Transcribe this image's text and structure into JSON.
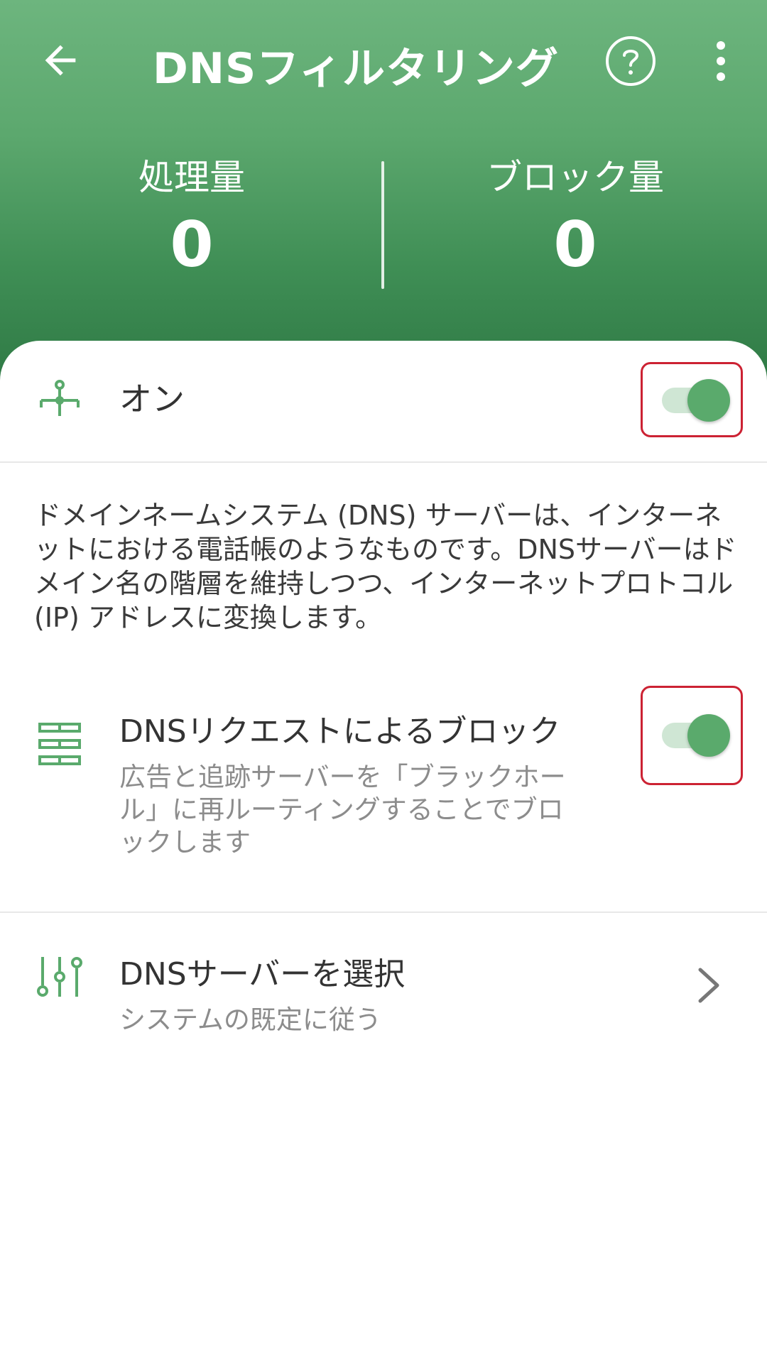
{
  "header": {
    "title": "DNSフィルタリング",
    "stats": {
      "processed_label": "処理量",
      "processed_value": "0",
      "blocked_label": "ブロック量",
      "blocked_value": "0"
    }
  },
  "main": {
    "on_row": {
      "label": "オン",
      "toggle_on": true
    },
    "description": "ドメインネームシステム (DNS) サーバーは、インターネットにおける電話帳のようなものです。DNSサーバーはドメイン名の階層を維持しつつ、インターネットプロトコル (IP) アドレスに変換します。",
    "block_row": {
      "title": "DNSリクエストによるブロック",
      "subtitle": "広告と追跡サーバーを「ブラックホール」に再ルーティングすることでブロックします",
      "toggle_on": true
    },
    "server_row": {
      "title": "DNSサーバーを選択",
      "subtitle": "システムの既定に従う"
    }
  },
  "colors": {
    "accent": "#5aaa6c",
    "header_top": "#6db57e",
    "header_bottom": "#2f7a45",
    "highlight": "#cc2233"
  }
}
